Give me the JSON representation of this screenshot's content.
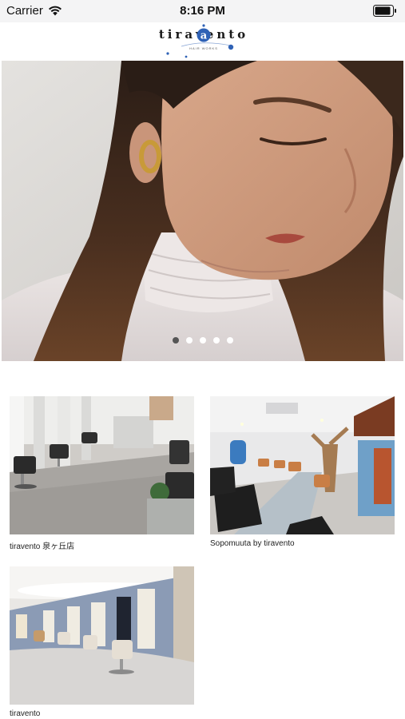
{
  "status_bar": {
    "carrier": "Carrier",
    "time": "8:16 PM"
  },
  "header": {
    "logo_text": "tiravento",
    "logo_subtext": "HAIR WORKS"
  },
  "carousel": {
    "page_count": 5,
    "active_index": 0
  },
  "shops": [
    {
      "name": "tiravento 泉ヶ丘店"
    },
    {
      "name": "Sopomuuta by tiravento"
    },
    {
      "name": "tiravento"
    }
  ]
}
